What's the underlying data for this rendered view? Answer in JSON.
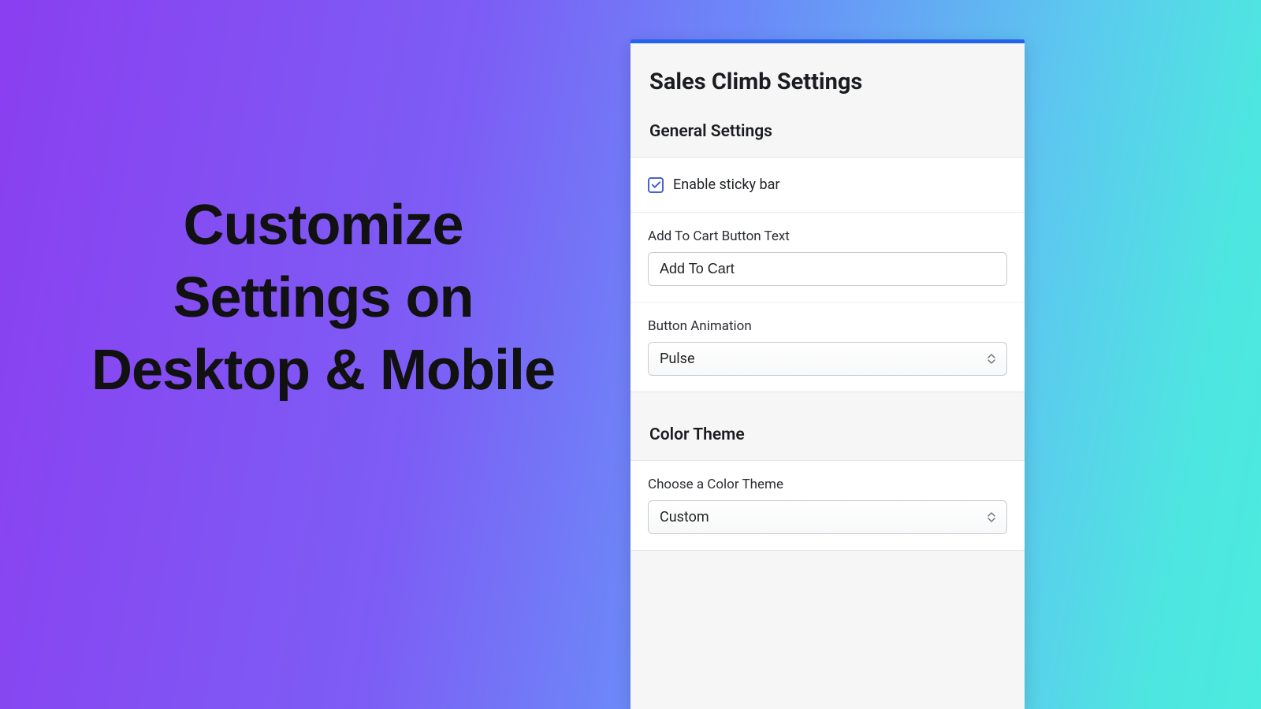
{
  "hero": {
    "line1": "Customize",
    "line2": "Settings on",
    "line3": "Desktop & Mobile"
  },
  "panel": {
    "title": "Sales Climb Settings",
    "general": {
      "heading": "General Settings",
      "enable_sticky_label": "Enable sticky bar",
      "enable_sticky_checked": true,
      "atc_label": "Add To Cart Button Text",
      "atc_value": "Add To Cart",
      "anim_label": "Button Animation",
      "anim_value": "Pulse"
    },
    "color": {
      "heading": "Color Theme",
      "choose_label": "Choose a Color Theme",
      "choose_value": "Custom"
    }
  }
}
